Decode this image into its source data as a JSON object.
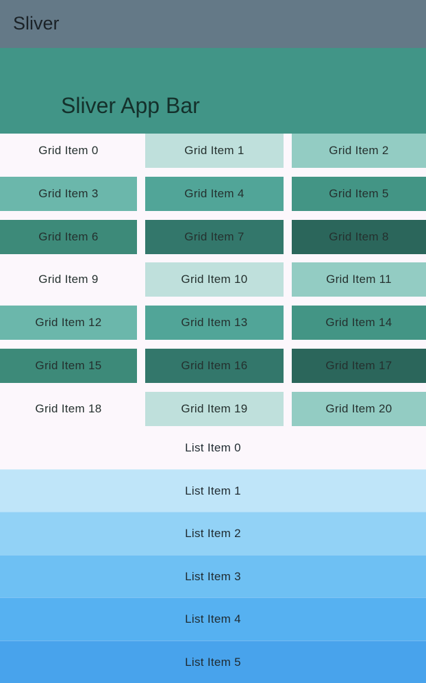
{
  "app_bar": {
    "title": "Sliver"
  },
  "sliver_app_bar": {
    "title": "Sliver App Bar"
  },
  "grid": {
    "items": [
      {
        "label": "Grid Item 0",
        "color": "#fcf7fc"
      },
      {
        "label": "Grid Item 1",
        "color": "#bfe0dc"
      },
      {
        "label": "Grid Item 2",
        "color": "#93ccc3"
      },
      {
        "label": "Grid Item 3",
        "color": "#6bb7ab"
      },
      {
        "label": "Grid Item 4",
        "color": "#51a598"
      },
      {
        "label": "Grid Item 5",
        "color": "#439585"
      },
      {
        "label": "Grid Item 6",
        "color": "#3d8a79"
      },
      {
        "label": "Grid Item 7",
        "color": "#33776b"
      },
      {
        "label": "Grid Item 8",
        "color": "#2b665b"
      },
      {
        "label": "Grid Item 9",
        "color": "#fcf7fc"
      },
      {
        "label": "Grid Item 10",
        "color": "#bfe0dc"
      },
      {
        "label": "Grid Item 11",
        "color": "#93ccc3"
      },
      {
        "label": "Grid Item 12",
        "color": "#6bb7ab"
      },
      {
        "label": "Grid Item 13",
        "color": "#51a598"
      },
      {
        "label": "Grid Item 14",
        "color": "#439585"
      },
      {
        "label": "Grid Item 15",
        "color": "#3d8a79"
      },
      {
        "label": "Grid Item 16",
        "color": "#33776b"
      },
      {
        "label": "Grid Item 17",
        "color": "#2b665b"
      },
      {
        "label": "Grid Item 18",
        "color": "#fcf7fc"
      },
      {
        "label": "Grid Item 19",
        "color": "#bfe0dc"
      },
      {
        "label": "Grid Item 20",
        "color": "#93ccc3"
      }
    ]
  },
  "list": {
    "items": [
      {
        "label": "List Item 0",
        "color": "#fcf7fc"
      },
      {
        "label": "List Item 1",
        "color": "#bfe5f9"
      },
      {
        "label": "List Item 2",
        "color": "#92d2f6"
      },
      {
        "label": "List Item 3",
        "color": "#6ec0f3"
      },
      {
        "label": "List Item 4",
        "color": "#56b1f1"
      },
      {
        "label": "List Item 5",
        "color": "#48a3ec"
      }
    ]
  }
}
